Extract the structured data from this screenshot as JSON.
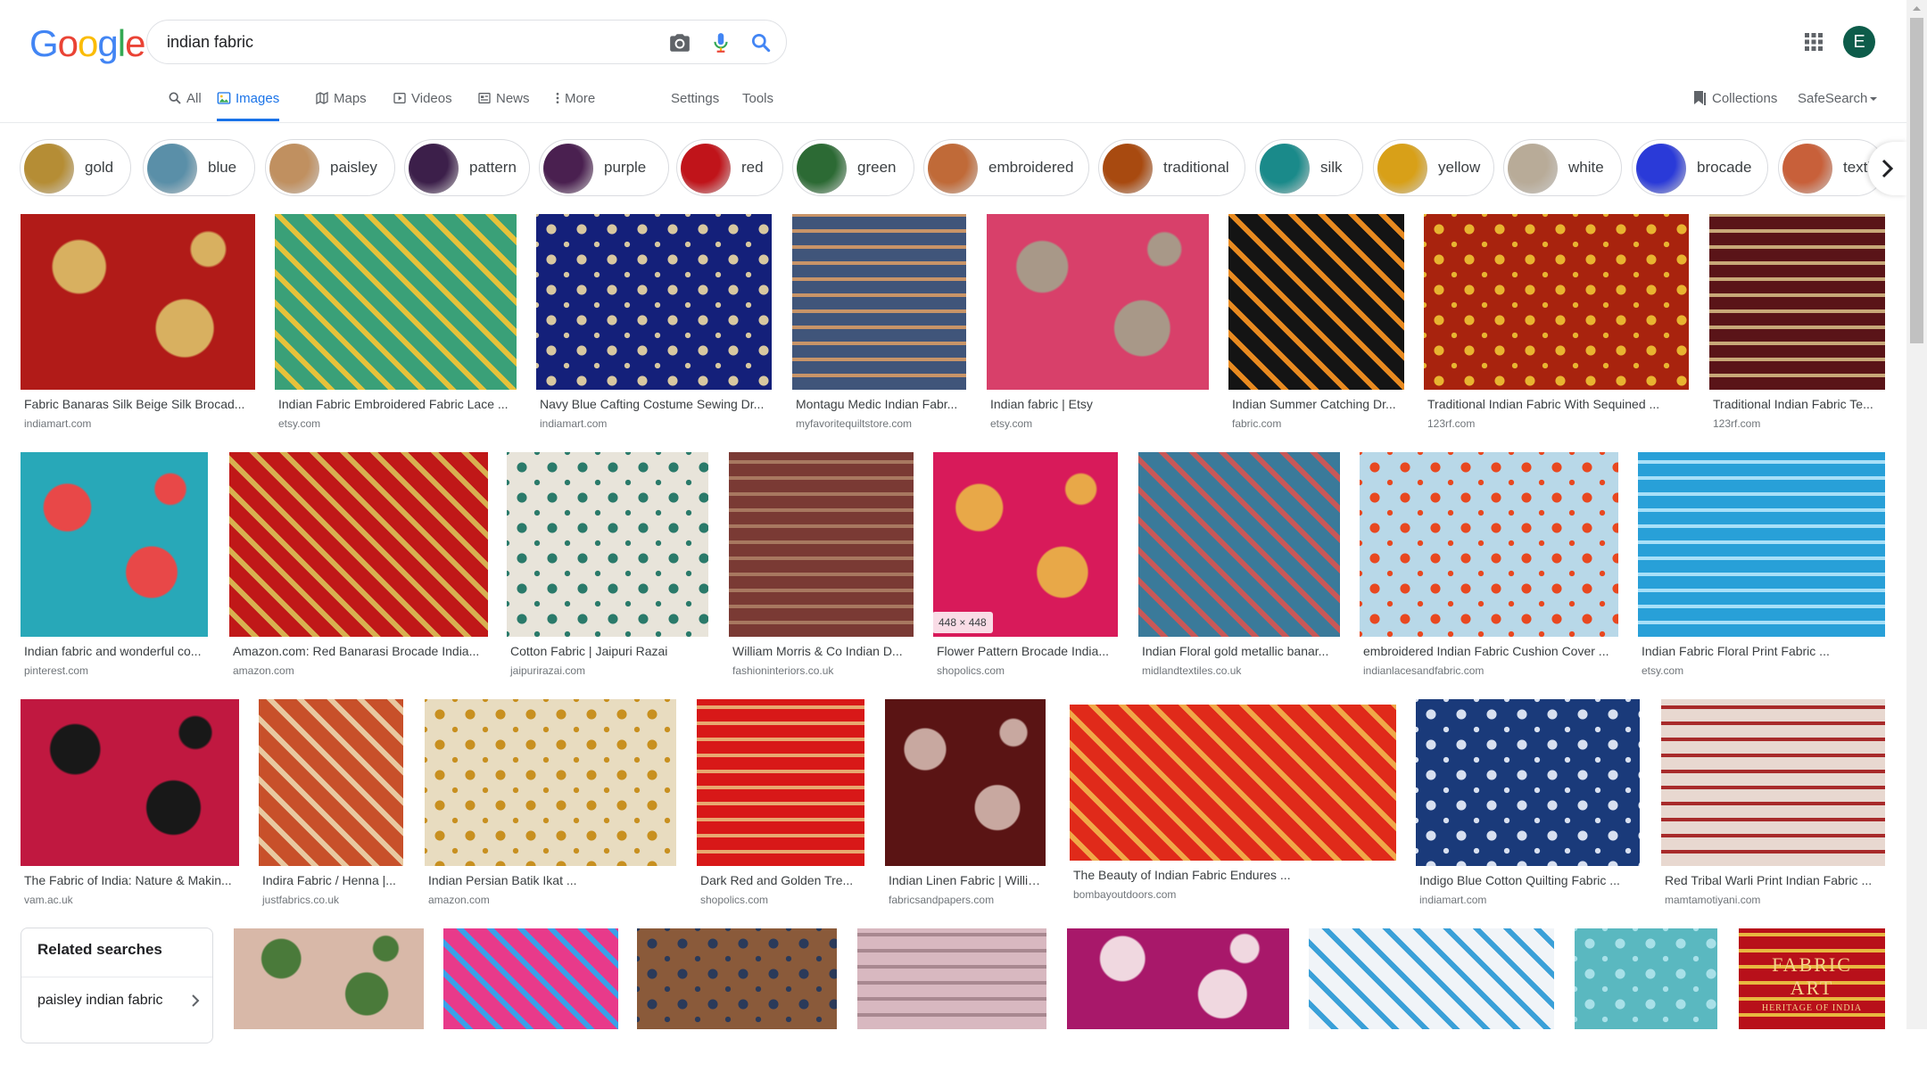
{
  "logo": {
    "text": "Google"
  },
  "search": {
    "query": "indian fabric"
  },
  "account": {
    "initial": "E"
  },
  "tabs": [
    {
      "label": "All",
      "icon": "search-icon"
    },
    {
      "label": "Images",
      "icon": "image-icon"
    },
    {
      "label": "Maps",
      "icon": "map-icon"
    },
    {
      "label": "Videos",
      "icon": "video-icon"
    },
    {
      "label": "News",
      "icon": "news-icon"
    },
    {
      "label": "More",
      "icon": "more-vert-icon"
    }
  ],
  "settings_label": "Settings",
  "tools_label": "Tools",
  "collections_label": "Collections",
  "safesearch_label": "SafeSearch",
  "chips": [
    {
      "label": "gold",
      "color": "#b58d35"
    },
    {
      "label": "blue",
      "color": "#5a8fa8"
    },
    {
      "label": "paisley",
      "color": "#c09060"
    },
    {
      "label": "pattern",
      "color": "#3c1f4a"
    },
    {
      "label": "purple",
      "color": "#4a2050"
    },
    {
      "label": "red",
      "color": "#c0141a"
    },
    {
      "label": "green",
      "color": "#2c6a34"
    },
    {
      "label": "embroidered",
      "color": "#c06a38"
    },
    {
      "label": "traditional",
      "color": "#a84a10"
    },
    {
      "label": "silk",
      "color": "#1a8a8a"
    },
    {
      "label": "yellow",
      "color": "#d8a018"
    },
    {
      "label": "white",
      "color": "#b8ab98"
    },
    {
      "label": "brocade",
      "color": "#2a3ad8"
    },
    {
      "label": "textile",
      "color": "#c8603a"
    }
  ],
  "results": [
    {
      "title": "Fabric Banaras Silk Beige Silk Brocad...",
      "source": "indiamart.com",
      "color": "#b11b18",
      "accent": "#d8b060"
    },
    {
      "title": "Indian Fabric Embroidered Fabric Lace ...",
      "source": "etsy.com",
      "color": "#3aa078",
      "accent": "#e6c23a"
    },
    {
      "title": "Navy Blue Cafting Costume Sewing Dr...",
      "source": "indiamart.com",
      "color": "#14207a",
      "accent": "#d8c8a0"
    },
    {
      "title": "Montagu Medic Indian Fabr...",
      "source": "myfavoritequiltstore.com",
      "color": "#40557a",
      "accent": "#c89468"
    },
    {
      "title": "Indian fabric | Etsy",
      "source": "etsy.com",
      "color": "#d8406a",
      "accent": "#a89888"
    },
    {
      "title": "Indian Summer Catching Dr...",
      "source": "fabric.com",
      "color": "#141414",
      "accent": "#e88a20"
    },
    {
      "title": "Traditional Indian Fabric With Sequined ...",
      "source": "123rf.com",
      "color": "#a8230e",
      "accent": "#e8b430"
    },
    {
      "title": "Traditional Indian Fabric Te...",
      "source": "123rf.com",
      "color": "#5a1418",
      "accent": "#c8a878"
    },
    {
      "title": "Indian fabric and wonderful co...",
      "source": "pinterest.com",
      "color": "#28a8b8",
      "accent": "#e84848"
    },
    {
      "title": "Amazon.com: Red Banarasi Brocade India...",
      "source": "amazon.com",
      "color": "#c01818",
      "accent": "#d8b050"
    },
    {
      "title": "Cotton Fabric | Jaipuri Razai",
      "source": "jaipurirazai.com",
      "color": "#e8e4da",
      "accent": "#2a7a6a"
    },
    {
      "title": "William Morris & Co Indian D...",
      "source": "fashioninteriors.co.uk",
      "color": "#7a3a34",
      "accent": "#a87860"
    },
    {
      "title": "Flower Pattern Brocade India...",
      "source": "shopolics.com",
      "color": "#d81a5a",
      "accent": "#e8a848"
    },
    {
      "title": "Indian Floral gold metallic banar...",
      "source": "midlandtextiles.co.uk",
      "color": "#3a7a9a",
      "accent": "#c85858"
    },
    {
      "title": "embroidered Indian Fabric Cushion Cover ...",
      "source": "indianlacesandfabric.com",
      "color": "#b8d8e8",
      "accent": "#e84820"
    },
    {
      "title": "Indian Fabric Floral Print Fabric ...",
      "source": "etsy.com",
      "color": "#28a0d8",
      "accent": "#a8e0f8"
    },
    {
      "title": "The Fabric of India: Nature & Makin...",
      "source": "vam.ac.uk",
      "color": "#c01840",
      "accent": "#181818"
    },
    {
      "title": "Indira Fabric / Henna |...",
      "source": "justfabrics.co.uk",
      "color": "#c8502a",
      "accent": "#e8c8a0"
    },
    {
      "title": "Indian Persian Batik Ikat ...",
      "source": "amazon.com",
      "color": "#e8dcc0",
      "accent": "#c89020"
    },
    {
      "title": "Dark Red and Golden Tre...",
      "source": "shopolics.com",
      "color": "#d81818",
      "accent": "#e8a870"
    },
    {
      "title": "Indian Linen Fabric | Willia...",
      "source": "fabricsandpapers.com",
      "color": "#5a1414",
      "accent": "#c8a8a0"
    },
    {
      "title": "The Beauty of Indian Fabric Endures ...",
      "source": "bombayoutdoors.com",
      "color": "#e02a1a",
      "accent": "#f0a848"
    },
    {
      "title": "Indigo Blue Cotton Quilting Fabric ...",
      "source": "indiamart.com",
      "color": "#1a3a7a",
      "accent": "#d8e0f0"
    },
    {
      "title": "Red Tribal Warli Print Indian Fabric ...",
      "source": "mamtamotiyani.com",
      "color": "#e8d8d0",
      "accent": "#a82a2a"
    },
    {
      "title": "",
      "source": "",
      "color": "#d8b8a8",
      "accent": "#4a7a3a"
    },
    {
      "title": "",
      "source": "",
      "color": "#e83a8a",
      "accent": "#3aa0e8"
    },
    {
      "title": "",
      "source": "",
      "color": "#8a5a3a",
      "accent": "#2a3a5a"
    },
    {
      "title": "",
      "source": "",
      "color": "#d8b8c0",
      "accent": "#a88890"
    },
    {
      "title": "",
      "source": "",
      "color": "#a8186a",
      "accent": "#f0d8e0"
    },
    {
      "title": "",
      "source": "",
      "color": "#f0f4f8",
      "accent": "#3aa0d8"
    },
    {
      "title": "",
      "source": "",
      "color": "#5ab8c0",
      "accent": "#a8e0e8"
    },
    {
      "title": "",
      "source": "",
      "color": "#b8101a",
      "accent": "#e8b840"
    }
  ],
  "hover_dimensions": "448 × 448",
  "fabric_art_text": {
    "line1": "FABRIC",
    "line2": "ART",
    "line3": "HERITAGE OF INDIA"
  },
  "related": {
    "title": "Related searches",
    "items": [
      {
        "label": "paisley indian fabric"
      }
    ]
  }
}
